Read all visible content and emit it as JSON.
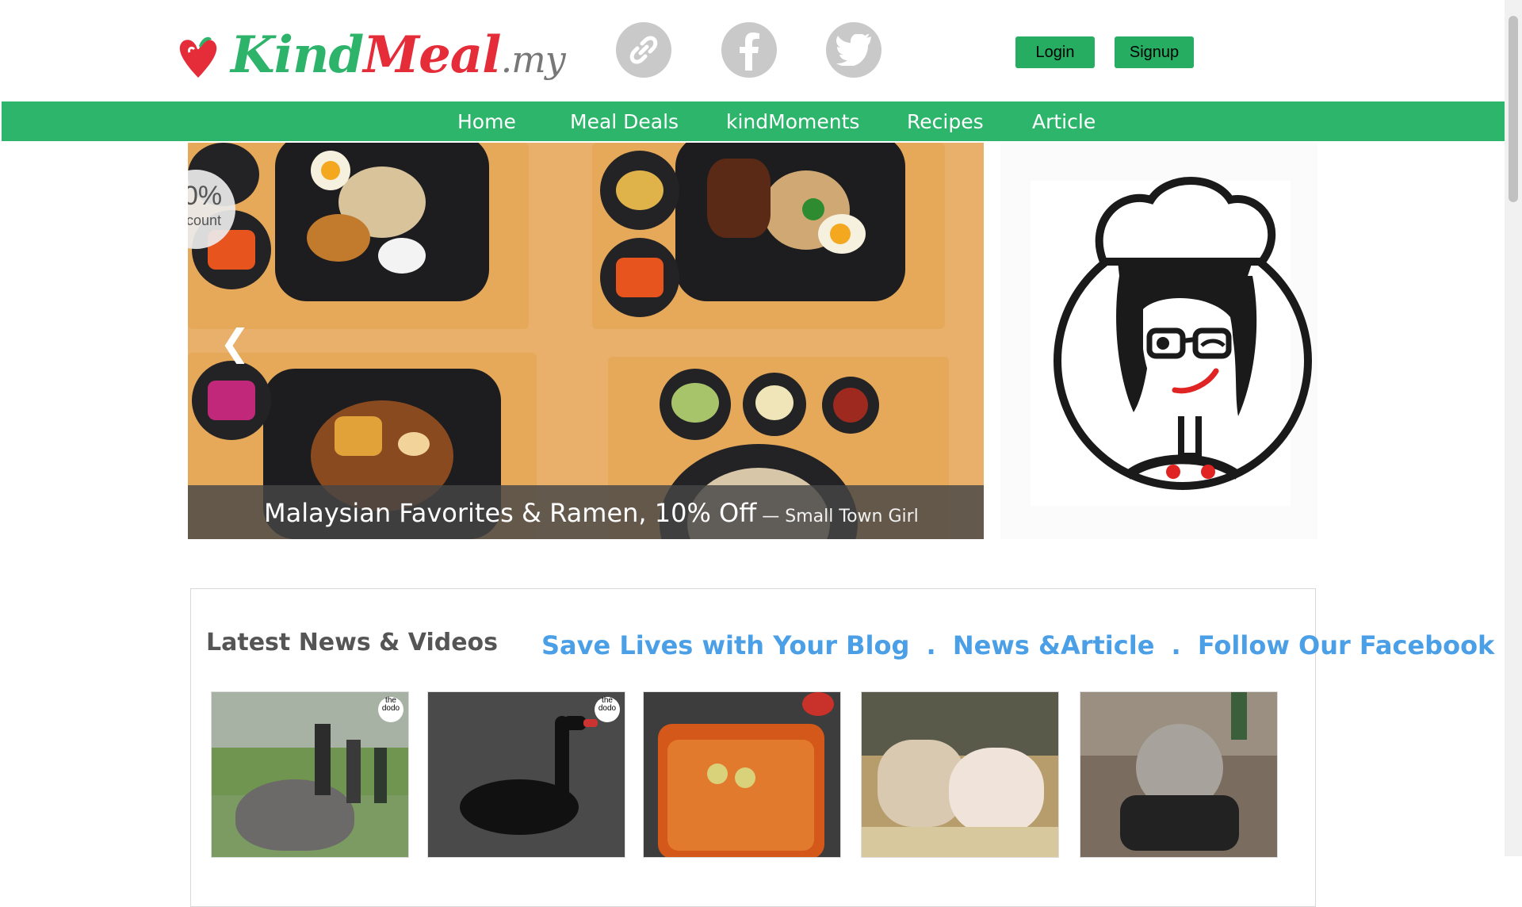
{
  "logo": {
    "kind": "Kind",
    "meal": "Meal",
    "suffix": ".my"
  },
  "social": [
    "link-icon",
    "facebook-icon",
    "twitter-icon"
  ],
  "auth": {
    "login": "Login",
    "signup": "Signup"
  },
  "nav": {
    "items": [
      "Home",
      "Meal Deals",
      "kindMoments",
      "Recipes",
      "Article"
    ]
  },
  "hero": {
    "badge_top": "0%",
    "badge_bottom": "count",
    "caption_main": "Malaysian Favorites & Ramen, 10% Off",
    "caption_sub": " — Small Town Girl"
  },
  "news": {
    "title": "Latest News & Videos",
    "links": [
      "Save Lives with Your Blog",
      ".",
      "News &Article",
      ".",
      "Follow Our Facebook"
    ],
    "thumbnails": [
      {
        "label": "the dodo",
        "scene": "elephants"
      },
      {
        "label": "the dodo",
        "scene": "black-swan"
      },
      {
        "label": "",
        "scene": "stew"
      },
      {
        "label": "",
        "scene": "calf-and-pig"
      },
      {
        "label": "",
        "scene": "seal-in-tub"
      }
    ]
  },
  "colors": {
    "brand_green": "#2db56b",
    "brand_red": "#e52d3a",
    "link_blue": "#4a9fe6"
  }
}
